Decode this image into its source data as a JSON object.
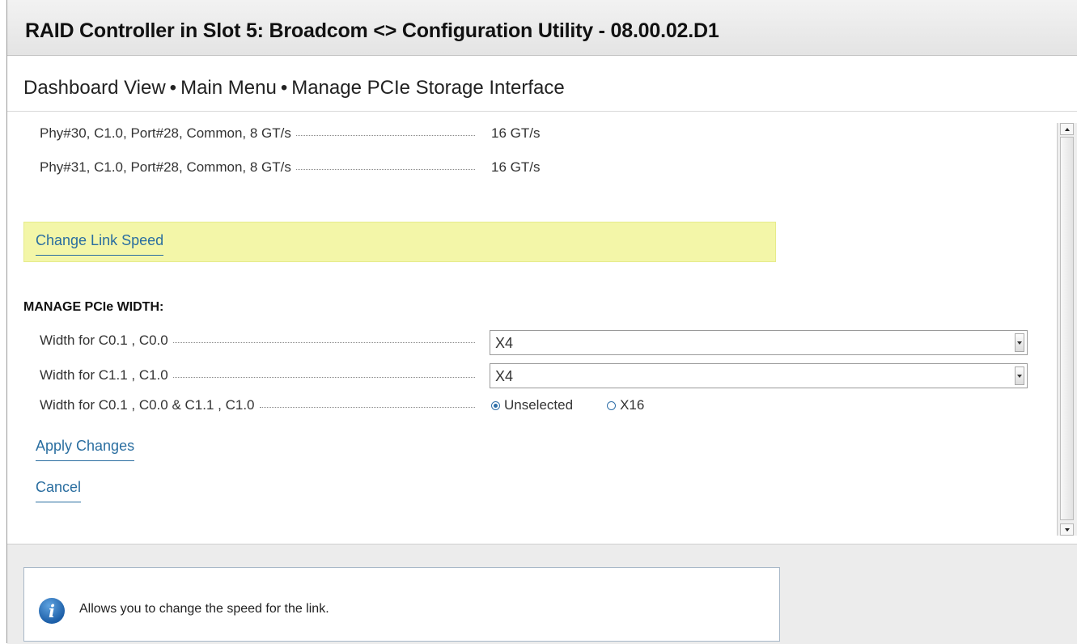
{
  "window": {
    "title": "RAID Controller in Slot 5: Broadcom <> Configuration Utility - 08.00.02.D1"
  },
  "breadcrumb": [
    "Dashboard View",
    "Main Menu",
    "Manage PCIe Storage Interface"
  ],
  "phy_rows": [
    {
      "label": "Phy#30, C1.0, Port#28, Common, 8 GT/s",
      "value": "16 GT/s"
    },
    {
      "label": "Phy#31, C1.0, Port#28, Common, 8 GT/s",
      "value": "16 GT/s"
    }
  ],
  "change_link_speed_label": "Change Link Speed",
  "manage_width": {
    "section_title": "MANAGE PCIe WIDTH:",
    "width_c0": {
      "label": "Width for C0.1 , C0.0",
      "value": "X4"
    },
    "width_c1": {
      "label": "Width for C1.1 , C1.0",
      "value": "X4"
    },
    "width_combined": {
      "label": "Width for C0.1 , C0.0 & C1.1 , C1.0",
      "options": [
        {
          "label": "Unselected",
          "selected": true
        },
        {
          "label": "X16",
          "selected": false
        }
      ]
    }
  },
  "actions": {
    "apply_label": "Apply Changes",
    "cancel_label": "Cancel"
  },
  "help": {
    "icon": "info-icon",
    "text": "Allows you to change the speed for the link."
  },
  "colors": {
    "link": "#2a6ea0",
    "highlight": "#f3f6a8",
    "info_icon": "#1d5fa8"
  }
}
